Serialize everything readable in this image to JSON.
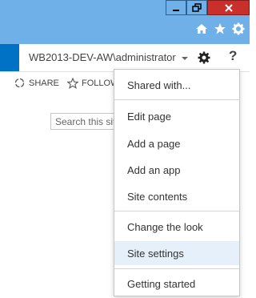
{
  "window": {
    "buttons": [
      "minimize",
      "restore",
      "close"
    ]
  },
  "browser": {
    "icons": [
      "home-icon",
      "star-icon",
      "gear-icon"
    ]
  },
  "suitebar": {
    "user": "WB2013-DEV-AW\\administrator",
    "help": "?"
  },
  "ribbon": {
    "share": "SHARE",
    "follow": "FOLLOW"
  },
  "search": {
    "placeholder": "Search this site"
  },
  "menu": {
    "items": [
      {
        "label": "Shared with..."
      },
      {
        "label": "Edit page"
      },
      {
        "label": "Add a page"
      },
      {
        "label": "Add an app"
      },
      {
        "label": "Site contents"
      },
      {
        "label": "Change the look"
      },
      {
        "label": "Site settings",
        "highlighted": true
      },
      {
        "label": "Getting started"
      }
    ]
  },
  "colors": {
    "brand": "#0072c6",
    "highlight": "#e5f0fa",
    "close": "#c9302c",
    "chrome": "#6fb0e8"
  }
}
